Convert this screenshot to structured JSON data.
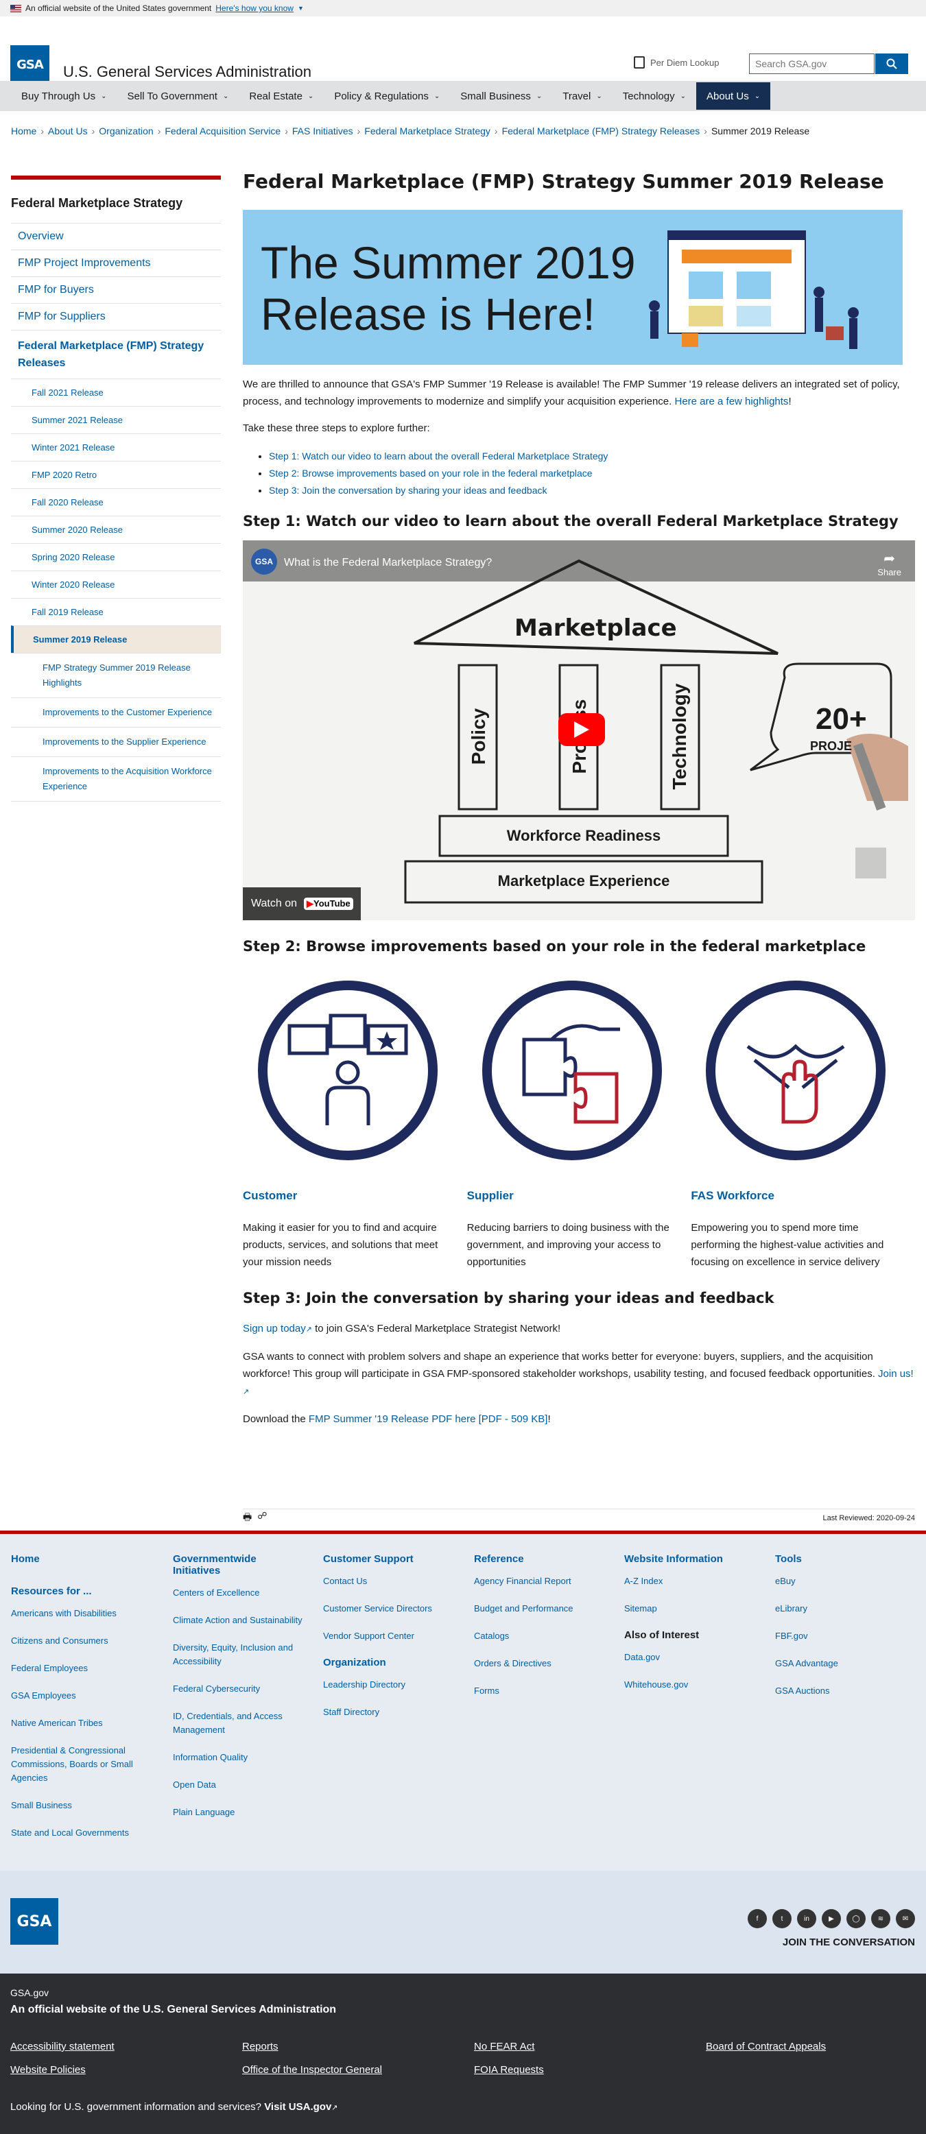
{
  "banner": {
    "text": "An official website of the United States government",
    "link": "Here's how you know"
  },
  "header": {
    "logo": "GSA",
    "agency": "U.S. General Services Administration",
    "per_diem": "Per Diem Lookup",
    "search_placeholder": "Search GSA.gov"
  },
  "nav": [
    {
      "label": "Buy Through Us"
    },
    {
      "label": "Sell To Government"
    },
    {
      "label": "Real Estate"
    },
    {
      "label": "Policy & Regulations"
    },
    {
      "label": "Small Business"
    },
    {
      "label": "Travel"
    },
    {
      "label": "Technology"
    },
    {
      "label": "About Us"
    }
  ],
  "breadcrumb": [
    "Home",
    "About Us",
    "Organization",
    "Federal Acquisition Service",
    "FAS Initiatives",
    "Federal Marketplace Strategy",
    "Federal Marketplace (FMP) Strategy Releases",
    "Summer 2019 Release"
  ],
  "sidebar": {
    "title": "Federal Marketplace Strategy",
    "items": [
      "Overview",
      "FMP Project Improvements",
      "FMP for Buyers",
      "FMP for Suppliers"
    ],
    "section": "Federal Marketplace (FMP) Strategy Releases",
    "releases": [
      "Fall 2021 Release",
      "Summer 2021 Release",
      "Winter 2021 Release",
      "FMP 2020 Retro",
      "Fall 2020 Release",
      "Summer 2020 Release",
      "Spring 2020 Release",
      "Winter 2020 Release",
      "Fall 2019 Release"
    ],
    "current": "Summer 2019 Release",
    "sub": [
      "FMP Strategy Summer 2019 Release Highlights",
      "Improvements to the Customer Experience",
      "Improvements to the Supplier Experience",
      "Improvements to the Acquisition Workforce Experience"
    ]
  },
  "main": {
    "title": "Federal Marketplace (FMP) Strategy Summer 2019 Release",
    "hero_line1": "The Summer 2019",
    "hero_line2": "Release is Here!",
    "intro": "We are thrilled to announce that GSA's FMP Summer '19 Release is available! The FMP Summer '19 release delivers an integrated set of policy, process, and technology improvements to modernize and simplify your acquisition experience. ",
    "intro_link": "Here are a few highlights",
    "steps_intro": "Take these three steps to explore further:",
    "steps": [
      "Step 1: Watch our video to learn about the overall Federal Marketplace Strategy",
      "Step 2: Browse improvements based on your role in the federal marketplace",
      "Step 3: Join the conversation by sharing your ideas and feedback"
    ],
    "h_step1": "Step 1: Watch our video to learn about the overall Federal Marketplace Strategy",
    "video": {
      "title": "What is the Federal Marketplace Strategy?",
      "share": "Share",
      "watch_on": "Watch on",
      "youtube": "YouTube",
      "chan": "GSA",
      "board": {
        "roof": "Marketplace",
        "p1": "Policy",
        "p2": "Process",
        "p3": "Technology",
        "base1": "Workforce Readiness",
        "base2": "Marketplace Experience",
        "bubble1": "20+",
        "bubble2": "PROJE"
      }
    },
    "h_step2": "Step 2: Browse improvements based on your role in the federal marketplace",
    "roles": [
      {
        "title": "Customer",
        "desc": "Making it easier for you to find and acquire products, services, and solutions that meet your mission needs"
      },
      {
        "title": "Supplier",
        "desc": "Reducing barriers to doing business with the government, and improving your access to opportunities"
      },
      {
        "title": "FAS Workforce",
        "desc": "Empowering you to spend more time performing the highest-value activities and focusing on excellence in service delivery"
      }
    ],
    "h_step3": "Step 3: Join the conversation by sharing your ideas and feedback",
    "signup_link": "Sign up today",
    "signup_rest": " to join GSA's Federal Marketplace Strategist Network!",
    "connect": "GSA wants to connect with problem solvers and shape an experience that works better for everyone: buyers, suppliers, and the acquisition workforce! This group will participate in GSA FMP-sponsored stakeholder workshops, usability testing, and focused feedback opportunities. ",
    "join_link": "Join us!",
    "download_pre": "Download the ",
    "download_link": "FMP Summer '19 Release PDF here [PDF - 509 KB]",
    "download_post": "!",
    "last_reviewed": "Last Reviewed: 2020-09-24"
  },
  "footer": {
    "col1": {
      "home": "Home",
      "resources": "Resources for ...",
      "links": [
        "Americans with Disabilities",
        "Citizens and Consumers",
        "Federal Employees",
        "GSA Employees",
        "Native American Tribes",
        "Presidential & Congressional Commissions, Boards or Small Agencies",
        "Small Business",
        "State and Local Governments"
      ]
    },
    "col2": {
      "title": "Governmentwide Initiatives",
      "links": [
        "Centers of Excellence",
        "Climate Action and Sustainability",
        "Diversity, Equity, Inclusion and Accessibility",
        "Federal Cybersecurity",
        "ID, Credentials, and Access Management",
        "Information Quality",
        "Open Data",
        "Plain Language"
      ]
    },
    "col3": {
      "title": "Customer Support",
      "links": [
        "Contact Us",
        "Customer Service Directors",
        "Vendor Support Center"
      ],
      "title2": "Organization",
      "links2": [
        "Leadership Directory",
        "Staff Directory"
      ]
    },
    "col4": {
      "title": "Reference",
      "links": [
        "Agency Financial Report",
        "Budget and Performance",
        "Catalogs",
        "Orders & Directives",
        "Forms"
      ]
    },
    "col5": {
      "title": "Website Information",
      "links": [
        "A-Z Index",
        "Sitemap"
      ],
      "title2": "Also of Interest",
      "links2": [
        "Data.gov",
        "Whitehouse.gov"
      ]
    },
    "col6": {
      "title": "Tools",
      "links": [
        "eBuy",
        "eLibrary",
        "FBF.gov",
        "GSA Advantage",
        "GSA Auctions"
      ]
    },
    "join": "JOIN THE CONVERSATION",
    "site": "GSA.gov",
    "official": "An official website of the U.S. General Services Administration",
    "bottom_links": [
      "Accessibility statement",
      "Reports",
      "No FEAR Act",
      "Board of Contract Appeals",
      "Website Policies",
      "Office of the Inspector General",
      "FOIA Requests"
    ],
    "usa_pre": "Looking for U.S. government information and services? ",
    "usa_link": "Visit USA.gov"
  }
}
